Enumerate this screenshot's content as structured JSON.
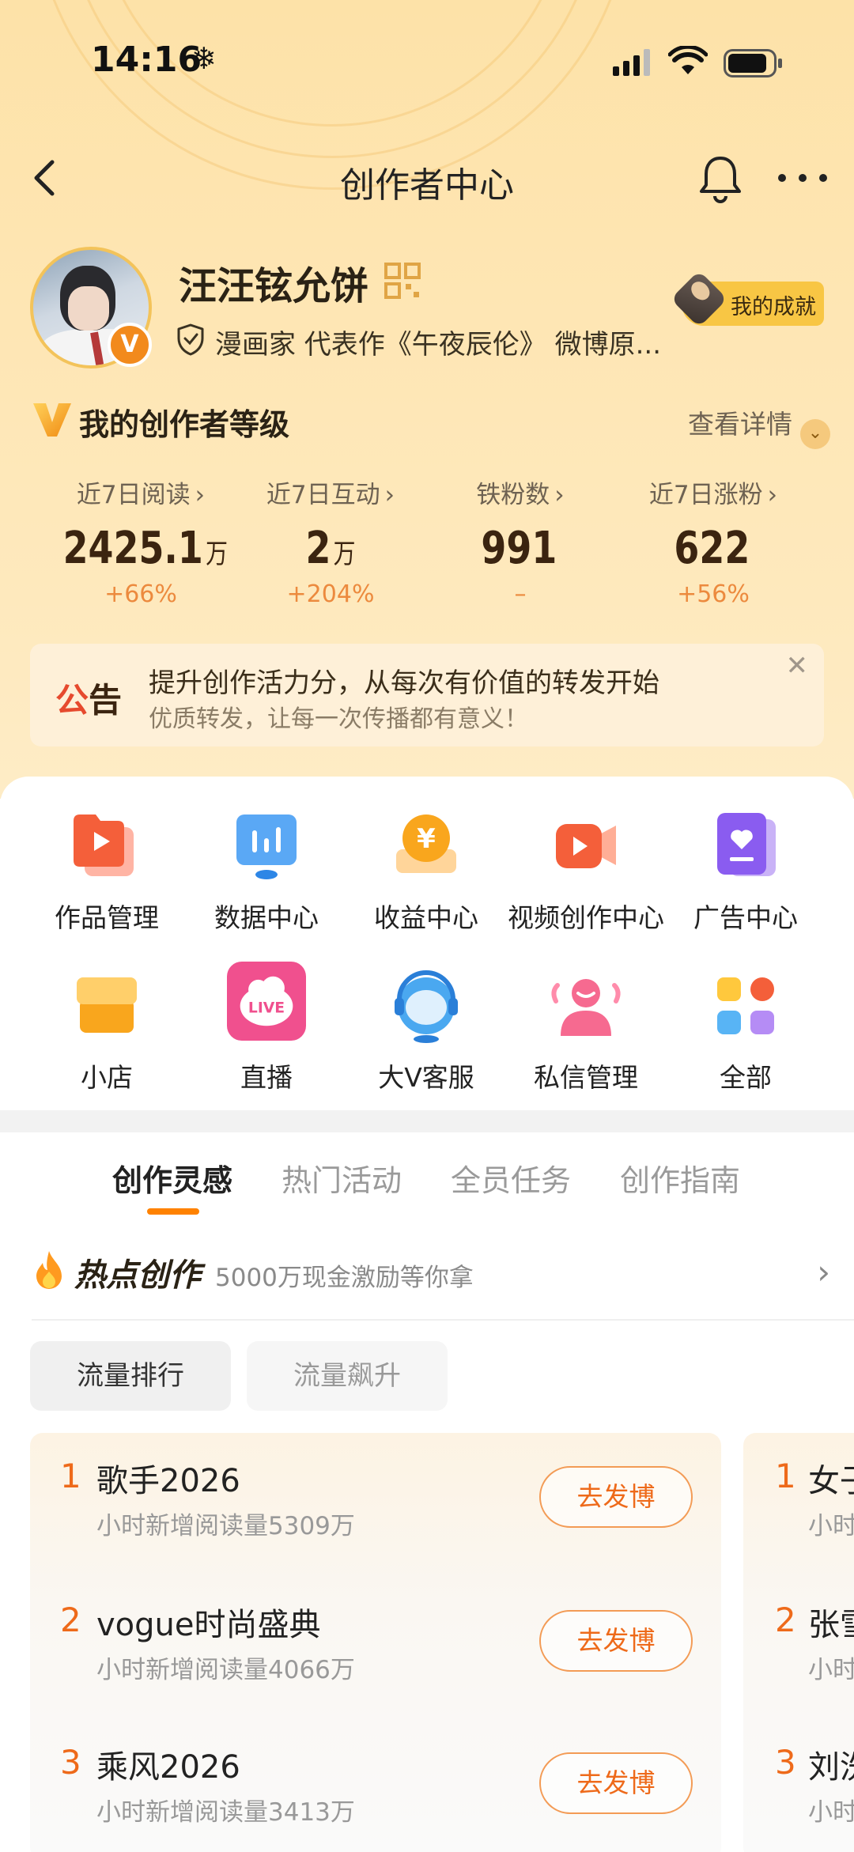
{
  "status": {
    "time": "14:16"
  },
  "nav": {
    "title": "创作者中心"
  },
  "profile": {
    "name": "汪汪铉允饼",
    "bio": "漫画家 代表作《午夜辰伦》 微博原...",
    "achievement": "我的成就"
  },
  "level": {
    "title": "我的创作者等级",
    "detail": "查看详情"
  },
  "stats": [
    {
      "label": "近7日阅读",
      "value": "2425.1",
      "unit": "万",
      "change": "+66%"
    },
    {
      "label": "近7日互动",
      "value": "2",
      "unit": "万",
      "change": "+204%"
    },
    {
      "label": "铁粉数",
      "value": "991",
      "unit": "",
      "change": "–"
    },
    {
      "label": "近7日涨粉",
      "value": "622",
      "unit": "",
      "change": "+56%"
    }
  ],
  "notice": {
    "tag_a": "公",
    "tag_b": "告",
    "line1": "提升创作活力分，从每次有价值的转发开始",
    "line2": "优质转发，让每一次传播都有意义！"
  },
  "grid": [
    {
      "label": "作品管理",
      "icon": "works-icon"
    },
    {
      "label": "数据中心",
      "icon": "data-icon"
    },
    {
      "label": "收益中心",
      "icon": "income-icon"
    },
    {
      "label": "视频创作中心",
      "icon": "video-icon"
    },
    {
      "label": "广告中心",
      "icon": "ad-icon"
    },
    {
      "label": "小店",
      "icon": "shop-icon"
    },
    {
      "label": "直播",
      "icon": "live-icon"
    },
    {
      "label": "大V客服",
      "icon": "service-icon"
    },
    {
      "label": "私信管理",
      "icon": "message-icon"
    },
    {
      "label": "全部",
      "icon": "all-icon"
    }
  ],
  "live_text": "LIVE",
  "tabs": [
    "创作灵感",
    "热门活动",
    "全员任务",
    "创作指南"
  ],
  "hot": {
    "title": "热点创作",
    "subtitle": "5000万现金激励等你拿"
  },
  "chips": [
    "流量排行",
    "流量飙升"
  ],
  "ranking": [
    {
      "rank": "1",
      "title": "歌手2026",
      "meta": "小时新增阅读量5309万",
      "button": "去发博"
    },
    {
      "rank": "2",
      "title": "vogue时尚盛典",
      "meta": "小时新增阅读量4066万",
      "button": "去发博"
    },
    {
      "rank": "3",
      "title": "乘风2026",
      "meta": "小时新增阅读量3413万",
      "button": "去发博"
    }
  ],
  "ranking2": [
    {
      "rank": "1",
      "title": "女子",
      "meta": "小时"
    },
    {
      "rank": "2",
      "title": "张雪",
      "meta": "小时"
    },
    {
      "rank": "3",
      "title": "刘洗",
      "meta": "小时"
    }
  ],
  "colors": {
    "accent": "#ff8200",
    "rank": "#ee6a1a",
    "hero_bg": "#fde2a8"
  }
}
